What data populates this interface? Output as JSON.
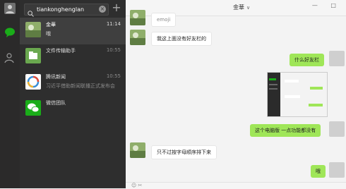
{
  "search": {
    "value": "tiankonghenglan",
    "clear_label": "×",
    "add_label": "+"
  },
  "chats": [
    {
      "name": "金華",
      "preview": "哦",
      "time": "11:14",
      "active": true
    },
    {
      "name": "文件传输助手",
      "preview": "",
      "time": "10:55",
      "active": false
    },
    {
      "name": "腾讯新闻",
      "preview": "习近平借助新闻联播正式发布会",
      "time": "10:55",
      "active": false
    },
    {
      "name": "微信团队",
      "preview": "",
      "time": "",
      "active": false
    }
  ],
  "conversation": {
    "title": "金華",
    "title_chevron": "∨",
    "window_buttons": "— □",
    "messages": [
      {
        "side": "in",
        "text": "emoji"
      },
      {
        "side": "in",
        "text": "我这上面没有好友栏的"
      },
      {
        "side": "out",
        "text": "什么好友栏"
      },
      {
        "side": "out",
        "text": "这个电脑版 一点功能都没有"
      },
      {
        "side": "in",
        "text": "只不过按字母顺序排下来"
      },
      {
        "side": "out",
        "text": "哦"
      }
    ],
    "input_icons": "☺ ✂"
  },
  "colors": {
    "rail": "#2b2a2a",
    "list": "#2e2e2e",
    "out_bubble": "#9fe658",
    "accent": "#1aad19"
  }
}
